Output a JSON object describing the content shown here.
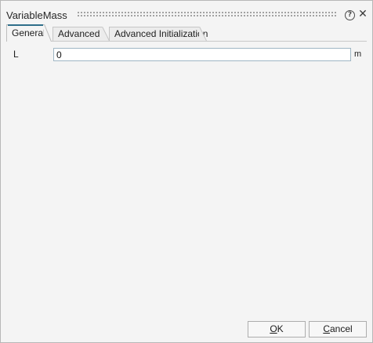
{
  "window": {
    "title": "VariableMass",
    "help_glyph": "?",
    "close_glyph": "✕"
  },
  "tabs": [
    {
      "label": "General",
      "active": true
    },
    {
      "label": "Advanced",
      "active": false
    },
    {
      "label": "Advanced Initialization",
      "active": false
    }
  ],
  "fields": {
    "L": {
      "label": "L",
      "value": "0",
      "unit": "m"
    }
  },
  "buttons": {
    "ok": {
      "mnemonic": "O",
      "rest": "K"
    },
    "cancel": {
      "mnemonic": "C",
      "rest": "ancel"
    }
  },
  "icons": {
    "help": "help-icon",
    "close": "close-icon",
    "grip": "drag-grip-icon"
  },
  "colors": {
    "background": "#f4f4f4",
    "active_tab_accent": "#2f6f8a",
    "input_border": "#9fb6c4"
  }
}
